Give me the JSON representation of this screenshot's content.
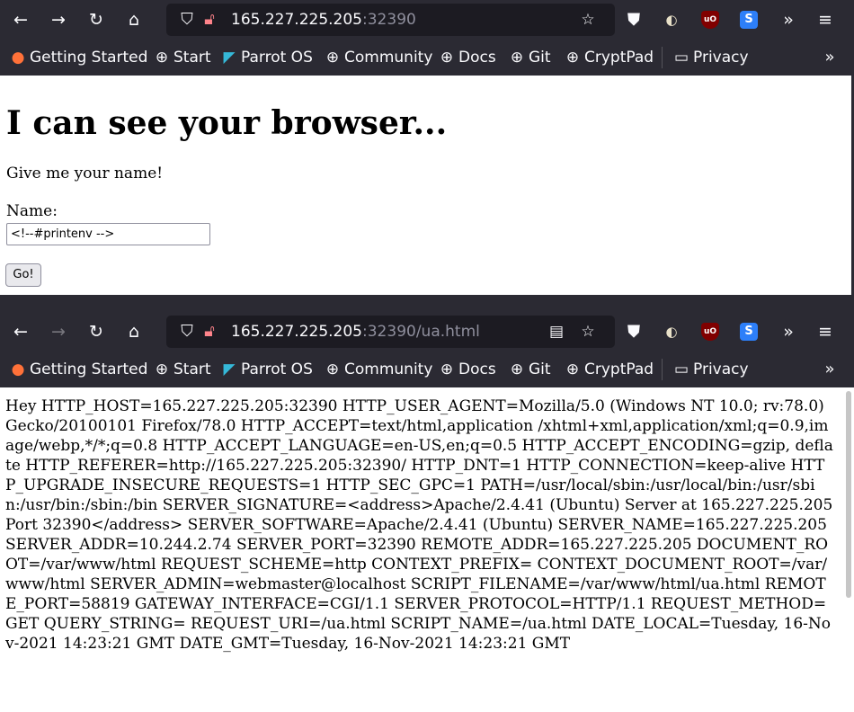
{
  "windows": [
    {
      "url": {
        "host": "165.227.225.205",
        "path": ":32390"
      },
      "page": {
        "title": "I can see your browser...",
        "subtitle": "Give me your name!",
        "name_label": "Name:",
        "name_value": "<!--#printenv -->",
        "button_label": "Go!"
      }
    },
    {
      "url": {
        "host": "165.227.225.205",
        "path": ":32390/ua.html"
      },
      "page": {
        "env_text": "Hey HTTP_HOST=165.227.225.205:32390 HTTP_USER_AGENT=Mozilla/5.0 (Windows NT 10.0; rv:78.0) Gecko/20100101 Firefox/78.0 HTTP_ACCEPT=text/html,application /xhtml+xml,application/xml;q=0.9,image/webp,*/*;q=0.8 HTTP_ACCEPT_LANGUAGE=en-US,en;q=0.5 HTTP_ACCEPT_ENCODING=gzip, deflate HTTP_REFERER=http://165.227.225.205:32390/ HTTP_DNT=1 HTTP_CONNECTION=keep-alive HTTP_UPGRADE_INSECURE_REQUESTS=1 HTTP_SEC_GPC=1 PATH=/usr/local/sbin:/usr/local/bin:/usr/sbin:/usr/bin:/sbin:/bin SERVER_SIGNATURE=<address>Apache/2.4.41 (Ubuntu) Server at 165.227.225.205 Port 32390</address> SERVER_SOFTWARE=Apache/2.4.41 (Ubuntu) SERVER_NAME=165.227.225.205 SERVER_ADDR=10.244.2.74 SERVER_PORT=32390 REMOTE_ADDR=165.227.225.205 DOCUMENT_ROOT=/var/www/html REQUEST_SCHEME=http CONTEXT_PREFIX= CONTEXT_DOCUMENT_ROOT=/var/www/html SERVER_ADMIN=webmaster@localhost SCRIPT_FILENAME=/var/www/html/ua.html REMOTE_PORT=58819 GATEWAY_INTERFACE=CGI/1.1 SERVER_PROTOCOL=HTTP/1.1 REQUEST_METHOD=GET QUERY_STRING= REQUEST_URI=/ua.html SCRIPT_NAME=/ua.html DATE_LOCAL=Tuesday, 16-Nov-2021 14:23:21 GMT DATE_GMT=Tuesday, 16-Nov-2021 14:23:21 GMT"
      }
    }
  ],
  "bookmarks": [
    "Getting Started",
    "Start",
    "Parrot OS",
    "Community",
    "Docs",
    "Git",
    "CryptPad",
    "Privacy"
  ],
  "icons": {
    "back": "arrow-left-icon",
    "forward": "arrow-right-icon",
    "reload": "reload-icon",
    "home": "home-icon",
    "shield": "shield-icon",
    "lock": "lock-icon",
    "reader": "reader-view-icon",
    "star": "star-icon",
    "pocket": "pocket-icon",
    "ublock": "ublock-icon",
    "overflow": "chevron-double-right-icon",
    "menu": "hamburger-menu-icon"
  },
  "colors": {
    "chrome": "#2b2a33",
    "urlbar": "#1c1b22",
    "lock": "#ff848b"
  }
}
